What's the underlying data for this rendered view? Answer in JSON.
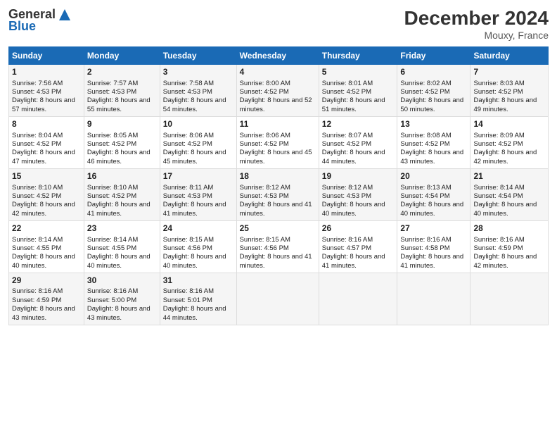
{
  "logo": {
    "general": "General",
    "blue": "Blue"
  },
  "title": "December 2024",
  "location": "Mouxy, France",
  "days_of_week": [
    "Sunday",
    "Monday",
    "Tuesday",
    "Wednesday",
    "Thursday",
    "Friday",
    "Saturday"
  ],
  "weeks": [
    [
      {
        "day": "1",
        "sunrise": "Sunrise: 7:56 AM",
        "sunset": "Sunset: 4:53 PM",
        "daylight": "Daylight: 8 hours and 57 minutes."
      },
      {
        "day": "2",
        "sunrise": "Sunrise: 7:57 AM",
        "sunset": "Sunset: 4:53 PM",
        "daylight": "Daylight: 8 hours and 55 minutes."
      },
      {
        "day": "3",
        "sunrise": "Sunrise: 7:58 AM",
        "sunset": "Sunset: 4:53 PM",
        "daylight": "Daylight: 8 hours and 54 minutes."
      },
      {
        "day": "4",
        "sunrise": "Sunrise: 8:00 AM",
        "sunset": "Sunset: 4:52 PM",
        "daylight": "Daylight: 8 hours and 52 minutes."
      },
      {
        "day": "5",
        "sunrise": "Sunrise: 8:01 AM",
        "sunset": "Sunset: 4:52 PM",
        "daylight": "Daylight: 8 hours and 51 minutes."
      },
      {
        "day": "6",
        "sunrise": "Sunrise: 8:02 AM",
        "sunset": "Sunset: 4:52 PM",
        "daylight": "Daylight: 8 hours and 50 minutes."
      },
      {
        "day": "7",
        "sunrise": "Sunrise: 8:03 AM",
        "sunset": "Sunset: 4:52 PM",
        "daylight": "Daylight: 8 hours and 49 minutes."
      }
    ],
    [
      {
        "day": "8",
        "sunrise": "Sunrise: 8:04 AM",
        "sunset": "Sunset: 4:52 PM",
        "daylight": "Daylight: 8 hours and 47 minutes."
      },
      {
        "day": "9",
        "sunrise": "Sunrise: 8:05 AM",
        "sunset": "Sunset: 4:52 PM",
        "daylight": "Daylight: 8 hours and 46 minutes."
      },
      {
        "day": "10",
        "sunrise": "Sunrise: 8:06 AM",
        "sunset": "Sunset: 4:52 PM",
        "daylight": "Daylight: 8 hours and 45 minutes."
      },
      {
        "day": "11",
        "sunrise": "Sunrise: 8:06 AM",
        "sunset": "Sunset: 4:52 PM",
        "daylight": "Daylight: 8 hours and 45 minutes."
      },
      {
        "day": "12",
        "sunrise": "Sunrise: 8:07 AM",
        "sunset": "Sunset: 4:52 PM",
        "daylight": "Daylight: 8 hours and 44 minutes."
      },
      {
        "day": "13",
        "sunrise": "Sunrise: 8:08 AM",
        "sunset": "Sunset: 4:52 PM",
        "daylight": "Daylight: 8 hours and 43 minutes."
      },
      {
        "day": "14",
        "sunrise": "Sunrise: 8:09 AM",
        "sunset": "Sunset: 4:52 PM",
        "daylight": "Daylight: 8 hours and 42 minutes."
      }
    ],
    [
      {
        "day": "15",
        "sunrise": "Sunrise: 8:10 AM",
        "sunset": "Sunset: 4:52 PM",
        "daylight": "Daylight: 8 hours and 42 minutes."
      },
      {
        "day": "16",
        "sunrise": "Sunrise: 8:10 AM",
        "sunset": "Sunset: 4:52 PM",
        "daylight": "Daylight: 8 hours and 41 minutes."
      },
      {
        "day": "17",
        "sunrise": "Sunrise: 8:11 AM",
        "sunset": "Sunset: 4:53 PM",
        "daylight": "Daylight: 8 hours and 41 minutes."
      },
      {
        "day": "18",
        "sunrise": "Sunrise: 8:12 AM",
        "sunset": "Sunset: 4:53 PM",
        "daylight": "Daylight: 8 hours and 41 minutes."
      },
      {
        "day": "19",
        "sunrise": "Sunrise: 8:12 AM",
        "sunset": "Sunset: 4:53 PM",
        "daylight": "Daylight: 8 hours and 40 minutes."
      },
      {
        "day": "20",
        "sunrise": "Sunrise: 8:13 AM",
        "sunset": "Sunset: 4:54 PM",
        "daylight": "Daylight: 8 hours and 40 minutes."
      },
      {
        "day": "21",
        "sunrise": "Sunrise: 8:14 AM",
        "sunset": "Sunset: 4:54 PM",
        "daylight": "Daylight: 8 hours and 40 minutes."
      }
    ],
    [
      {
        "day": "22",
        "sunrise": "Sunrise: 8:14 AM",
        "sunset": "Sunset: 4:55 PM",
        "daylight": "Daylight: 8 hours and 40 minutes."
      },
      {
        "day": "23",
        "sunrise": "Sunrise: 8:14 AM",
        "sunset": "Sunset: 4:55 PM",
        "daylight": "Daylight: 8 hours and 40 minutes."
      },
      {
        "day": "24",
        "sunrise": "Sunrise: 8:15 AM",
        "sunset": "Sunset: 4:56 PM",
        "daylight": "Daylight: 8 hours and 40 minutes."
      },
      {
        "day": "25",
        "sunrise": "Sunrise: 8:15 AM",
        "sunset": "Sunset: 4:56 PM",
        "daylight": "Daylight: 8 hours and 41 minutes."
      },
      {
        "day": "26",
        "sunrise": "Sunrise: 8:16 AM",
        "sunset": "Sunset: 4:57 PM",
        "daylight": "Daylight: 8 hours and 41 minutes."
      },
      {
        "day": "27",
        "sunrise": "Sunrise: 8:16 AM",
        "sunset": "Sunset: 4:58 PM",
        "daylight": "Daylight: 8 hours and 41 minutes."
      },
      {
        "day": "28",
        "sunrise": "Sunrise: 8:16 AM",
        "sunset": "Sunset: 4:59 PM",
        "daylight": "Daylight: 8 hours and 42 minutes."
      }
    ],
    [
      {
        "day": "29",
        "sunrise": "Sunrise: 8:16 AM",
        "sunset": "Sunset: 4:59 PM",
        "daylight": "Daylight: 8 hours and 43 minutes."
      },
      {
        "day": "30",
        "sunrise": "Sunrise: 8:16 AM",
        "sunset": "Sunset: 5:00 PM",
        "daylight": "Daylight: 8 hours and 43 minutes."
      },
      {
        "day": "31",
        "sunrise": "Sunrise: 8:16 AM",
        "sunset": "Sunset: 5:01 PM",
        "daylight": "Daylight: 8 hours and 44 minutes."
      },
      {
        "day": "",
        "sunrise": "",
        "sunset": "",
        "daylight": ""
      },
      {
        "day": "",
        "sunrise": "",
        "sunset": "",
        "daylight": ""
      },
      {
        "day": "",
        "sunrise": "",
        "sunset": "",
        "daylight": ""
      },
      {
        "day": "",
        "sunrise": "",
        "sunset": "",
        "daylight": ""
      }
    ]
  ]
}
